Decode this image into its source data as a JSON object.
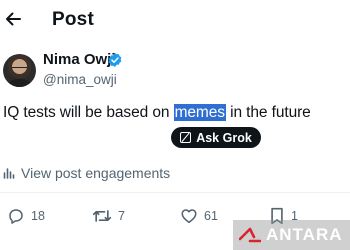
{
  "header": {
    "title": "Post",
    "back_icon": "arrow-left-icon"
  },
  "author": {
    "name": "Nima Owji",
    "handle": "@nima_owji",
    "verified_icon": "verified-badge-icon",
    "verified_color": "#1d9bf0"
  },
  "tweet": {
    "text_before": "IQ tests will be based on ",
    "highlighted": "memes",
    "text_after": " in the future",
    "highlight_color": "#2f6fd1"
  },
  "grok": {
    "label": "Ask Grok",
    "icon": "grok-icon"
  },
  "engagements": {
    "label": "View post engagements",
    "icon": "bar-chart-icon"
  },
  "actions": {
    "replies": "18",
    "reposts": "7",
    "likes": "61",
    "bookmarks": "1"
  },
  "watermark": {
    "label": "ANTARA",
    "logo_color": "#d7262e"
  }
}
